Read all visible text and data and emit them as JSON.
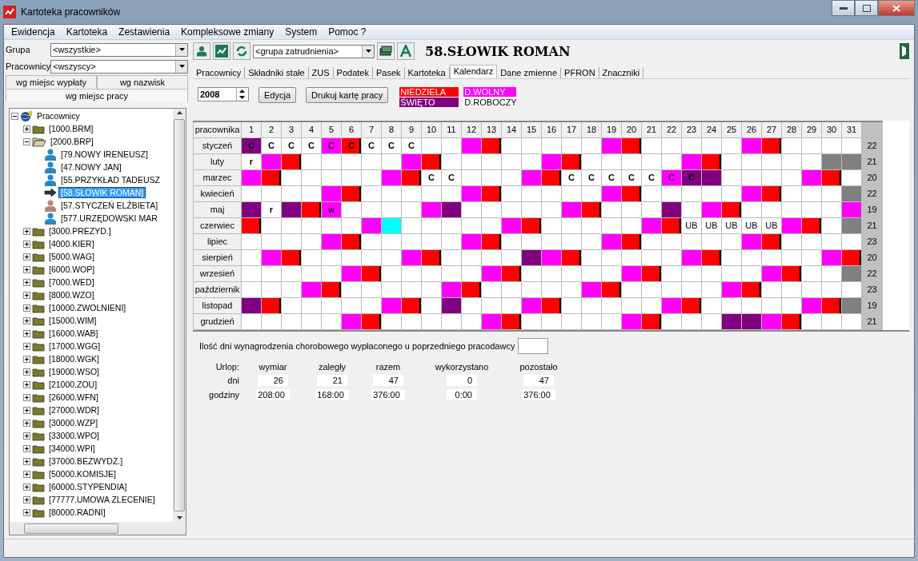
{
  "window": {
    "title": "Kartoteka pracowników"
  },
  "menu": [
    "Ewidencja",
    "Kartoteka",
    "Zestawienia",
    "Kompleksowe zmiany",
    "System",
    "Pomoc ?"
  ],
  "filters": [
    {
      "label": "Grupa",
      "value": "<wszystkie>"
    },
    {
      "label": "Pracownicy",
      "value": "<wszyscy>"
    }
  ],
  "side_tabs": [
    {
      "label": "wg miejsc wypłaty",
      "selected": false
    },
    {
      "label": "wg nazwisk",
      "selected": false
    },
    {
      "label": "wg miejsc pracy",
      "selected": true
    }
  ],
  "tree": {
    "label": "Pracownicy",
    "kind": "root",
    "expanded": true,
    "selected": false,
    "children": [
      {
        "label": "[1000.BRM]",
        "kind": "folder",
        "expanded": false,
        "selected": false
      },
      {
        "label": "[2000.BRP]",
        "kind": "folder",
        "expanded": true,
        "selected": false,
        "children": [
          {
            "label": "[79.NOWY IRENEUSZ]",
            "kind": "man",
            "selected": false
          },
          {
            "label": "[47.NOWY JAN]",
            "kind": "man",
            "selected": false
          },
          {
            "label": "[55.PRZYKŁAD TADEUSZ",
            "kind": "man",
            "selected": false
          },
          {
            "label": "[58.SŁOWIK ROMAN]",
            "kind": "current",
            "selected": true
          },
          {
            "label": "[57.STYCZEŃ ELŻBIETA]",
            "kind": "woman",
            "selected": false
          },
          {
            "label": "[577.URZĘDOWSKI MAR",
            "kind": "man",
            "selected": false
          }
        ]
      },
      {
        "label": "[3000.PREZYD.]",
        "kind": "folder",
        "expanded": false,
        "selected": false
      },
      {
        "label": "[4000.KIER]",
        "kind": "folder",
        "expanded": false,
        "selected": false
      },
      {
        "label": "[5000.WAG]",
        "kind": "folder",
        "expanded": false,
        "selected": false
      },
      {
        "label": "[6000.WOP]",
        "kind": "folder",
        "expanded": false,
        "selected": false
      },
      {
        "label": "[7000.WED]",
        "kind": "folder",
        "expanded": false,
        "selected": false
      },
      {
        "label": "[8000.WZO]",
        "kind": "folder",
        "expanded": false,
        "selected": false
      },
      {
        "label": "[10000.ZWOLNIENI]",
        "kind": "folder",
        "expanded": false,
        "selected": false
      },
      {
        "label": "[15000.WIM]",
        "kind": "folder",
        "expanded": false,
        "selected": false
      },
      {
        "label": "[16000.WAB]",
        "kind": "folder",
        "expanded": false,
        "selected": false
      },
      {
        "label": "[17000.WGG]",
        "kind": "folder",
        "expanded": false,
        "selected": false
      },
      {
        "label": "[18000.WGK]",
        "kind": "folder",
        "expanded": false,
        "selected": false
      },
      {
        "label": "[19000.WSO]",
        "kind": "folder",
        "expanded": false,
        "selected": false
      },
      {
        "label": "[21000.ZOU]",
        "kind": "folder",
        "expanded": false,
        "selected": false
      },
      {
        "label": "[26000.WFN]",
        "kind": "folder",
        "expanded": false,
        "selected": false
      },
      {
        "label": "[27000.WDR]",
        "kind": "folder",
        "expanded": false,
        "selected": false
      },
      {
        "label": "[30000.WZP]",
        "kind": "folder",
        "expanded": false,
        "selected": false
      },
      {
        "label": "[33000.WPO]",
        "kind": "folder",
        "expanded": false,
        "selected": false
      },
      {
        "label": "[34000.WPI]",
        "kind": "folder",
        "expanded": false,
        "selected": false
      },
      {
        "label": "[37000.BEZWYDZ.]",
        "kind": "folder",
        "expanded": false,
        "selected": false
      },
      {
        "label": "[50000.KOMISJE]",
        "kind": "folder",
        "expanded": false,
        "selected": false
      },
      {
        "label": "[60000.STYPENDIA]",
        "kind": "folder",
        "expanded": false,
        "selected": false
      },
      {
        "label": "[77777.UMOWA ZLECENIE]",
        "kind": "folder",
        "expanded": false,
        "selected": false
      },
      {
        "label": "[80000.RADNI]",
        "kind": "folder",
        "expanded": false,
        "selected": false
      }
    ]
  },
  "toolbar": {
    "group_combo": "<grupa zatrudnienia>",
    "employee_title": "58.SŁOWIK ROMAN"
  },
  "tabs": [
    {
      "label": "Pracownicy",
      "selected": false
    },
    {
      "label": "Składniki stałe",
      "selected": false
    },
    {
      "label": "ZUS",
      "selected": false
    },
    {
      "label": "Podatek",
      "selected": false
    },
    {
      "label": "Pasek",
      "selected": false
    },
    {
      "label": "Kartoteka",
      "selected": false
    },
    {
      "label": "Kalendarz",
      "selected": true
    },
    {
      "label": "Dane zmienne",
      "selected": false
    },
    {
      "label": "PFRON",
      "selected": false
    },
    {
      "label": "Znaczniki",
      "selected": false
    }
  ],
  "year": "2008",
  "buttons": [
    "Edycja",
    "Drukuj kartę pracy"
  ],
  "legend": [
    {
      "label": "NIEDZIELA",
      "kind": "sun"
    },
    {
      "label": "D.WOLNY",
      "kind": "free"
    },
    {
      "label": "ŚWIĘTO",
      "kind": "holiday"
    },
    {
      "label": "D.ROBOCZY",
      "kind": "work"
    }
  ],
  "calendar": {
    "corner": "pracownika",
    "days": [
      "1",
      "2",
      "3",
      "4",
      "5",
      "6",
      "7",
      "8",
      "9",
      "10",
      "11",
      "12",
      "13",
      "14",
      "15",
      "16",
      "17",
      "18",
      "19",
      "20",
      "21",
      "22",
      "23",
      "24",
      "25",
      "26",
      "27",
      "28",
      "29",
      "30",
      "31"
    ],
    "months": [
      {
        "name": "styczeń",
        "total": "22",
        "cells": [
          {
            "kind": "holiday",
            "text": "C"
          },
          {
            "kind": "work",
            "text": "C"
          },
          {
            "kind": "work",
            "text": "C"
          },
          {
            "kind": "work",
            "text": "C"
          },
          {
            "kind": "free",
            "text": "C"
          },
          {
            "kind": "sun",
            "text": "C"
          },
          {
            "kind": "work",
            "text": "C"
          },
          {
            "kind": "work",
            "text": "C"
          },
          {
            "kind": "work",
            "text": "C"
          },
          {
            "kind": "work"
          },
          {
            "kind": "work"
          },
          {
            "kind": "free"
          },
          {
            "kind": "sun"
          },
          {
            "kind": "work"
          },
          {
            "kind": "work"
          },
          {
            "kind": "work"
          },
          {
            "kind": "work"
          },
          {
            "kind": "work"
          },
          {
            "kind": "free"
          },
          {
            "kind": "sun"
          },
          {
            "kind": "work"
          },
          {
            "kind": "work"
          },
          {
            "kind": "work"
          },
          {
            "kind": "work"
          },
          {
            "kind": "work"
          },
          {
            "kind": "free"
          },
          {
            "kind": "sun"
          },
          {
            "kind": "work"
          },
          {
            "kind": "work"
          },
          {
            "kind": "work"
          },
          {
            "kind": "work"
          }
        ]
      },
      {
        "name": "luty",
        "total": "21",
        "cells": [
          {
            "kind": "work",
            "text": "r"
          },
          {
            "kind": "free"
          },
          {
            "kind": "sun"
          },
          {
            "kind": "work"
          },
          {
            "kind": "work"
          },
          {
            "kind": "work"
          },
          {
            "kind": "work"
          },
          {
            "kind": "work"
          },
          {
            "kind": "free"
          },
          {
            "kind": "sun"
          },
          {
            "kind": "work"
          },
          {
            "kind": "work"
          },
          {
            "kind": "work"
          },
          {
            "kind": "work"
          },
          {
            "kind": "work"
          },
          {
            "kind": "free"
          },
          {
            "kind": "sun"
          },
          {
            "kind": "work"
          },
          {
            "kind": "work"
          },
          {
            "kind": "work"
          },
          {
            "kind": "work"
          },
          {
            "kind": "work"
          },
          {
            "kind": "free"
          },
          {
            "kind": "sun"
          },
          {
            "kind": "work"
          },
          {
            "kind": "work"
          },
          {
            "kind": "work"
          },
          {
            "kind": "work"
          },
          {
            "kind": "work"
          },
          {
            "kind": "none"
          },
          {
            "kind": "none"
          }
        ]
      },
      {
        "name": "marzec",
        "total": "20",
        "cells": [
          {
            "kind": "free"
          },
          {
            "kind": "sun"
          },
          {
            "kind": "work"
          },
          {
            "kind": "work"
          },
          {
            "kind": "work"
          },
          {
            "kind": "work"
          },
          {
            "kind": "work"
          },
          {
            "kind": "free"
          },
          {
            "kind": "sun"
          },
          {
            "kind": "work",
            "text": "C"
          },
          {
            "kind": "work",
            "text": "C"
          },
          {
            "kind": "work"
          },
          {
            "kind": "work"
          },
          {
            "kind": "work"
          },
          {
            "kind": "free"
          },
          {
            "kind": "sun"
          },
          {
            "kind": "work",
            "text": "C"
          },
          {
            "kind": "work",
            "text": "C"
          },
          {
            "kind": "work",
            "text": "C"
          },
          {
            "kind": "work",
            "text": "C"
          },
          {
            "kind": "work",
            "text": "C"
          },
          {
            "kind": "free",
            "text": "C"
          },
          {
            "kind": "holiday",
            "text": "C"
          },
          {
            "kind": "holiday"
          },
          {
            "kind": "work"
          },
          {
            "kind": "work"
          },
          {
            "kind": "work"
          },
          {
            "kind": "work"
          },
          {
            "kind": "free"
          },
          {
            "kind": "sun"
          },
          {
            "kind": "work"
          }
        ]
      },
      {
        "name": "kwiecień",
        "total": "22",
        "cells": [
          {
            "kind": "work"
          },
          {
            "kind": "work"
          },
          {
            "kind": "work"
          },
          {
            "kind": "work"
          },
          {
            "kind": "free"
          },
          {
            "kind": "sun"
          },
          {
            "kind": "work"
          },
          {
            "kind": "work"
          },
          {
            "kind": "work"
          },
          {
            "kind": "work"
          },
          {
            "kind": "work"
          },
          {
            "kind": "free"
          },
          {
            "kind": "sun"
          },
          {
            "kind": "work"
          },
          {
            "kind": "work"
          },
          {
            "kind": "work"
          },
          {
            "kind": "work"
          },
          {
            "kind": "work"
          },
          {
            "kind": "free"
          },
          {
            "kind": "sun"
          },
          {
            "kind": "work"
          },
          {
            "kind": "work"
          },
          {
            "kind": "work"
          },
          {
            "kind": "work"
          },
          {
            "kind": "work"
          },
          {
            "kind": "free"
          },
          {
            "kind": "sun"
          },
          {
            "kind": "work"
          },
          {
            "kind": "work"
          },
          {
            "kind": "work"
          },
          {
            "kind": "none"
          }
        ]
      },
      {
        "name": "maj",
        "total": "19",
        "cells": [
          {
            "kind": "holiday"
          },
          {
            "kind": "work",
            "text": "r"
          },
          {
            "kind": "holiday"
          },
          {
            "kind": "sun"
          },
          {
            "kind": "free",
            "text": "w"
          },
          {
            "kind": "work"
          },
          {
            "kind": "work"
          },
          {
            "kind": "work"
          },
          {
            "kind": "work"
          },
          {
            "kind": "free"
          },
          {
            "kind": "holiday"
          },
          {
            "kind": "work"
          },
          {
            "kind": "work"
          },
          {
            "kind": "work"
          },
          {
            "kind": "work"
          },
          {
            "kind": "work"
          },
          {
            "kind": "free"
          },
          {
            "kind": "sun"
          },
          {
            "kind": "work"
          },
          {
            "kind": "work"
          },
          {
            "kind": "work"
          },
          {
            "kind": "holiday"
          },
          {
            "kind": "work"
          },
          {
            "kind": "free"
          },
          {
            "kind": "sun"
          },
          {
            "kind": "work"
          },
          {
            "kind": "work"
          },
          {
            "kind": "work"
          },
          {
            "kind": "work"
          },
          {
            "kind": "work"
          },
          {
            "kind": "free"
          }
        ]
      },
      {
        "name": "czerwiec",
        "total": "21",
        "cells": [
          {
            "kind": "sun"
          },
          {
            "kind": "work"
          },
          {
            "kind": "work"
          },
          {
            "kind": "work"
          },
          {
            "kind": "work"
          },
          {
            "kind": "work"
          },
          {
            "kind": "free"
          },
          {
            "kind": "mark"
          },
          {
            "kind": "work"
          },
          {
            "kind": "work"
          },
          {
            "kind": "work"
          },
          {
            "kind": "work"
          },
          {
            "kind": "work"
          },
          {
            "kind": "free"
          },
          {
            "kind": "sun"
          },
          {
            "kind": "work"
          },
          {
            "kind": "work"
          },
          {
            "kind": "work"
          },
          {
            "kind": "work"
          },
          {
            "kind": "work"
          },
          {
            "kind": "free"
          },
          {
            "kind": "sun"
          },
          {
            "kind": "work",
            "text": "UB"
          },
          {
            "kind": "work",
            "text": "UB"
          },
          {
            "kind": "work",
            "text": "UB"
          },
          {
            "kind": "work",
            "text": "UB"
          },
          {
            "kind": "work",
            "text": "UB"
          },
          {
            "kind": "free"
          },
          {
            "kind": "sun"
          },
          {
            "kind": "work"
          },
          {
            "kind": "none"
          }
        ]
      },
      {
        "name": "lipiec",
        "total": "23",
        "cells": [
          {
            "kind": "work"
          },
          {
            "kind": "work"
          },
          {
            "kind": "work"
          },
          {
            "kind": "work"
          },
          {
            "kind": "free"
          },
          {
            "kind": "sun"
          },
          {
            "kind": "work"
          },
          {
            "kind": "work"
          },
          {
            "kind": "work"
          },
          {
            "kind": "work"
          },
          {
            "kind": "work"
          },
          {
            "kind": "free"
          },
          {
            "kind": "sun"
          },
          {
            "kind": "work"
          },
          {
            "kind": "work"
          },
          {
            "kind": "work"
          },
          {
            "kind": "work"
          },
          {
            "kind": "work"
          },
          {
            "kind": "free"
          },
          {
            "kind": "sun"
          },
          {
            "kind": "work"
          },
          {
            "kind": "work"
          },
          {
            "kind": "work"
          },
          {
            "kind": "work"
          },
          {
            "kind": "work"
          },
          {
            "kind": "free"
          },
          {
            "kind": "sun"
          },
          {
            "kind": "work"
          },
          {
            "kind": "work"
          },
          {
            "kind": "work"
          },
          {
            "kind": "work"
          }
        ]
      },
      {
        "name": "sierpień",
        "total": "20",
        "cells": [
          {
            "kind": "work"
          },
          {
            "kind": "free"
          },
          {
            "kind": "sun"
          },
          {
            "kind": "work"
          },
          {
            "kind": "work"
          },
          {
            "kind": "work"
          },
          {
            "kind": "work"
          },
          {
            "kind": "work"
          },
          {
            "kind": "free"
          },
          {
            "kind": "sun"
          },
          {
            "kind": "work"
          },
          {
            "kind": "work"
          },
          {
            "kind": "work"
          },
          {
            "kind": "work"
          },
          {
            "kind": "holiday"
          },
          {
            "kind": "free"
          },
          {
            "kind": "sun"
          },
          {
            "kind": "work"
          },
          {
            "kind": "work"
          },
          {
            "kind": "work"
          },
          {
            "kind": "work"
          },
          {
            "kind": "work"
          },
          {
            "kind": "free"
          },
          {
            "kind": "sun"
          },
          {
            "kind": "work"
          },
          {
            "kind": "work"
          },
          {
            "kind": "work"
          },
          {
            "kind": "work"
          },
          {
            "kind": "work"
          },
          {
            "kind": "free"
          },
          {
            "kind": "sun"
          }
        ]
      },
      {
        "name": "wrzesień",
        "total": "22",
        "cells": [
          {
            "kind": "work"
          },
          {
            "kind": "work"
          },
          {
            "kind": "work"
          },
          {
            "kind": "work"
          },
          {
            "kind": "work"
          },
          {
            "kind": "free"
          },
          {
            "kind": "sun"
          },
          {
            "kind": "work"
          },
          {
            "kind": "work"
          },
          {
            "kind": "work"
          },
          {
            "kind": "work"
          },
          {
            "kind": "work"
          },
          {
            "kind": "free"
          },
          {
            "kind": "sun"
          },
          {
            "kind": "work"
          },
          {
            "kind": "work"
          },
          {
            "kind": "work"
          },
          {
            "kind": "work"
          },
          {
            "kind": "work"
          },
          {
            "kind": "free"
          },
          {
            "kind": "sun"
          },
          {
            "kind": "work"
          },
          {
            "kind": "work"
          },
          {
            "kind": "work"
          },
          {
            "kind": "work"
          },
          {
            "kind": "work"
          },
          {
            "kind": "free"
          },
          {
            "kind": "sun"
          },
          {
            "kind": "work"
          },
          {
            "kind": "work"
          },
          {
            "kind": "none"
          }
        ]
      },
      {
        "name": "październik",
        "total": "23",
        "cells": [
          {
            "kind": "work"
          },
          {
            "kind": "work"
          },
          {
            "kind": "work"
          },
          {
            "kind": "free"
          },
          {
            "kind": "sun"
          },
          {
            "kind": "work"
          },
          {
            "kind": "work"
          },
          {
            "kind": "work"
          },
          {
            "kind": "work"
          },
          {
            "kind": "work"
          },
          {
            "kind": "free"
          },
          {
            "kind": "sun"
          },
          {
            "kind": "work"
          },
          {
            "kind": "work"
          },
          {
            "kind": "work"
          },
          {
            "kind": "work"
          },
          {
            "kind": "work"
          },
          {
            "kind": "free"
          },
          {
            "kind": "sun"
          },
          {
            "kind": "work"
          },
          {
            "kind": "work"
          },
          {
            "kind": "work"
          },
          {
            "kind": "work"
          },
          {
            "kind": "work"
          },
          {
            "kind": "free"
          },
          {
            "kind": "sun"
          },
          {
            "kind": "work"
          },
          {
            "kind": "work"
          },
          {
            "kind": "work"
          },
          {
            "kind": "work"
          },
          {
            "kind": "work"
          }
        ]
      },
      {
        "name": "listopad",
        "total": "19",
        "cells": [
          {
            "kind": "holiday"
          },
          {
            "kind": "sun"
          },
          {
            "kind": "work"
          },
          {
            "kind": "work"
          },
          {
            "kind": "work"
          },
          {
            "kind": "work"
          },
          {
            "kind": "work"
          },
          {
            "kind": "free"
          },
          {
            "kind": "sun"
          },
          {
            "kind": "work"
          },
          {
            "kind": "holiday"
          },
          {
            "kind": "work"
          },
          {
            "kind": "work"
          },
          {
            "kind": "work"
          },
          {
            "kind": "free"
          },
          {
            "kind": "sun"
          },
          {
            "kind": "work"
          },
          {
            "kind": "work"
          },
          {
            "kind": "work"
          },
          {
            "kind": "work"
          },
          {
            "kind": "work"
          },
          {
            "kind": "free"
          },
          {
            "kind": "sun"
          },
          {
            "kind": "work"
          },
          {
            "kind": "work"
          },
          {
            "kind": "work"
          },
          {
            "kind": "work"
          },
          {
            "kind": "work"
          },
          {
            "kind": "free"
          },
          {
            "kind": "sun"
          },
          {
            "kind": "none"
          }
        ]
      },
      {
        "name": "grudzień",
        "total": "21",
        "cells": [
          {
            "kind": "work"
          },
          {
            "kind": "work"
          },
          {
            "kind": "work"
          },
          {
            "kind": "work"
          },
          {
            "kind": "work"
          },
          {
            "kind": "free"
          },
          {
            "kind": "sun"
          },
          {
            "kind": "work"
          },
          {
            "kind": "work"
          },
          {
            "kind": "work"
          },
          {
            "kind": "work"
          },
          {
            "kind": "work"
          },
          {
            "kind": "free"
          },
          {
            "kind": "sun"
          },
          {
            "kind": "work"
          },
          {
            "kind": "work"
          },
          {
            "kind": "work"
          },
          {
            "kind": "work"
          },
          {
            "kind": "work"
          },
          {
            "kind": "free"
          },
          {
            "kind": "sun"
          },
          {
            "kind": "work"
          },
          {
            "kind": "work"
          },
          {
            "kind": "work"
          },
          {
            "kind": "holiday"
          },
          {
            "kind": "holiday"
          },
          {
            "kind": "free"
          },
          {
            "kind": "sun"
          },
          {
            "kind": "work"
          },
          {
            "kind": "work"
          },
          {
            "kind": "work"
          }
        ]
      }
    ]
  },
  "sick_pay": {
    "label": "Ilość dni wynagrodzenia chorobowego wypłaconego u poprzedniego pracodawcy"
  },
  "leave": {
    "title": "Urlop:",
    "columns": [
      "wymiar",
      "zaległy",
      "razem",
      "wykorzystano",
      "pozostało"
    ],
    "rows": [
      {
        "label": "dni",
        "values": [
          "26",
          "21",
          "47",
          "0",
          "47"
        ]
      },
      {
        "label": "godziny",
        "values": [
          "208:00",
          "168:00",
          "376:00",
          "0:00",
          "376:00"
        ]
      }
    ]
  }
}
